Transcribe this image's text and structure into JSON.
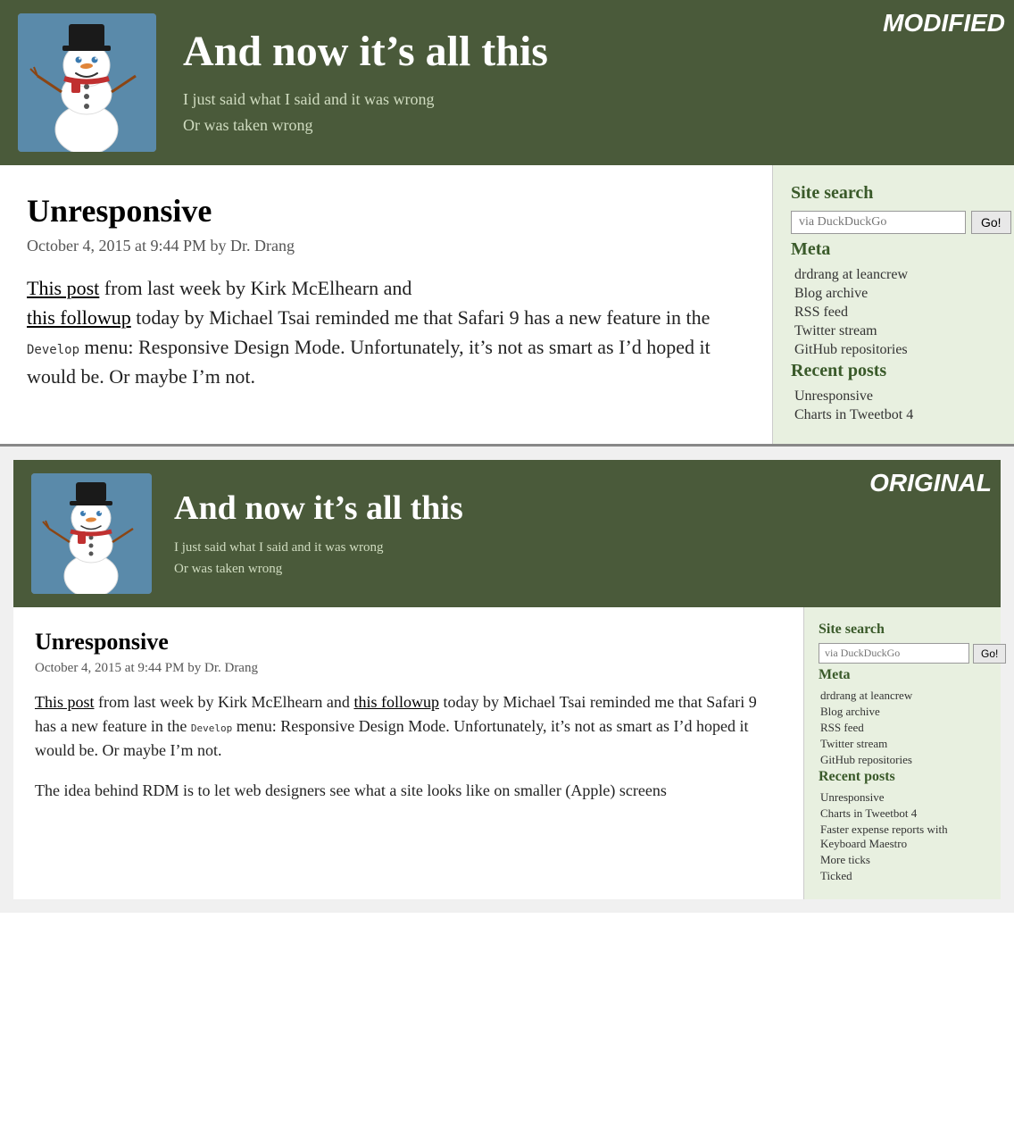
{
  "modified": {
    "label": "MODIFIED",
    "header": {
      "title": "And now it’s all this",
      "subtitle1": "I just said what I said and it was wrong",
      "subtitle2": "Or was taken wrong"
    },
    "post": {
      "title": "Unresponsive",
      "meta": "October 4, 2015 at 9:44 PM by Dr. Drang",
      "body_part1": "from last week by Kirk McElhearn and",
      "link1": "This post",
      "link2": "this followup",
      "body_part2": "today by Michael Tsai reminded me that Safari 9 has a new feature in the",
      "inline_code": "Develop",
      "body_part3": "menu: Responsive Design Mode. Unfortunately, it’s not as smart as I’d hoped it would be. Or maybe I’m not."
    },
    "sidebar": {
      "search_title": "Site search",
      "search_placeholder": "via DuckDuckGo",
      "search_btn": "Go!",
      "meta_title": "Meta",
      "meta_links": [
        "drdrang at leancrew",
        "Blog archive",
        "RSS feed",
        "Twitter stream",
        "GitHub repositories"
      ],
      "recent_title": "Recent posts",
      "recent_links": [
        "Unresponsive",
        "Charts in Tweetbot 4"
      ]
    }
  },
  "original": {
    "label": "ORIGINAL",
    "header": {
      "title": "And now it’s all this",
      "subtitle1": "I just said what I said and it was wrong",
      "subtitle2": "Or was taken wrong"
    },
    "post": {
      "title": "Unresponsive",
      "meta": "October 4, 2015 at 9:44 PM by Dr. Drang",
      "body_part1": "from last week by Kirk McElhearn and",
      "link1": "This post",
      "link2": "this followup",
      "body_part2": "today by Michael Tsai reminded me that Safari 9 has a new feature in the",
      "inline_code": "Develop",
      "body_part3": "menu: Responsive Design Mode. Unfortunately, it’s not as smart as I’d hoped it would be. Or maybe I’m not.",
      "body_part4": "The idea behind RDM is to let web designers see what a site looks like on smaller (Apple) screens"
    },
    "sidebar": {
      "search_title": "Site search",
      "search_placeholder": "via DuckDuckGo",
      "search_btn": "Go!",
      "meta_title": "Meta",
      "meta_links": [
        "drdrang at leancrew",
        "Blog archive",
        "RSS feed",
        "Twitter stream",
        "GitHub repositories"
      ],
      "recent_title": "Recent posts",
      "recent_links": [
        "Unresponsive",
        "Charts in Tweetbot 4",
        "Faster expense reports with Keyboard Maestro",
        "More ticks",
        "Ticked"
      ]
    }
  }
}
